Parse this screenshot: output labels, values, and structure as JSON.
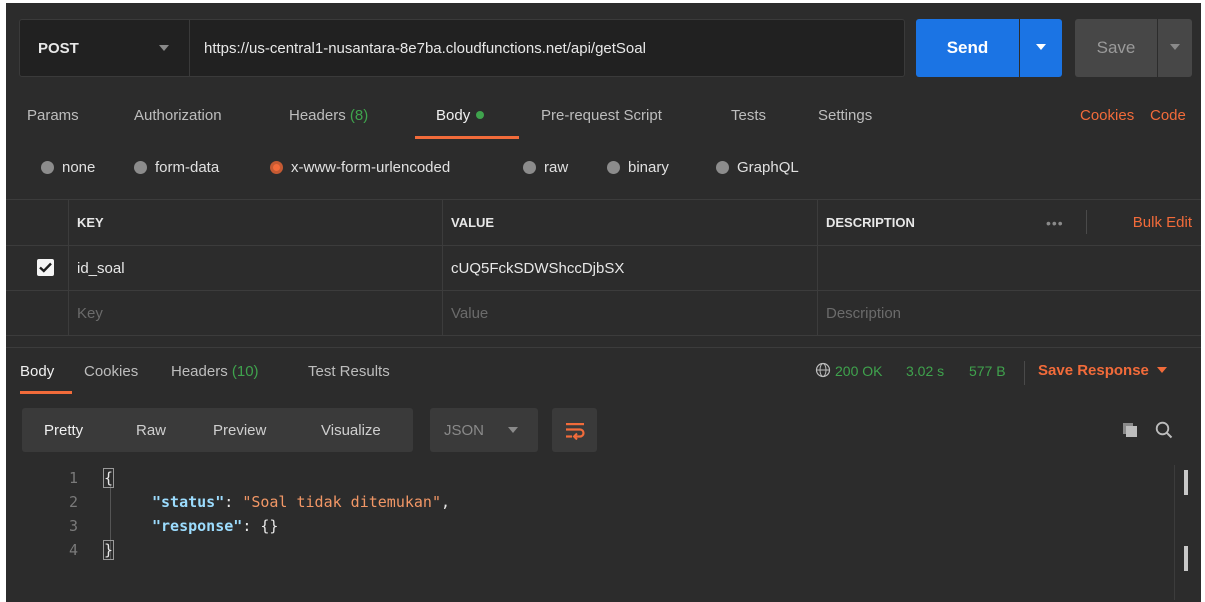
{
  "request": {
    "method": "POST",
    "url": "https://us-central1-nusantara-8e7ba.cloudfunctions.net/api/getSoal",
    "send_label": "Send",
    "save_label": "Save"
  },
  "request_tabs": {
    "params": "Params",
    "authorization": "Authorization",
    "headers": "Headers",
    "headers_count": "(8)",
    "body": "Body",
    "pre_request": "Pre-request Script",
    "tests": "Tests",
    "settings": "Settings",
    "cookies": "Cookies",
    "code": "Code"
  },
  "body_types": {
    "none": "none",
    "form_data": "form-data",
    "urlencoded": "x-www-form-urlencoded",
    "raw": "raw",
    "binary": "binary",
    "graphql": "GraphQL",
    "selected": "x-www-form-urlencoded"
  },
  "params_table": {
    "headers": {
      "key": "KEY",
      "value": "VALUE",
      "description": "DESCRIPTION"
    },
    "more": "•••",
    "bulk_edit": "Bulk Edit",
    "rows": [
      {
        "checked": true,
        "key": "id_soal",
        "value": "cUQ5FckSDWShccDjbSX",
        "description": ""
      }
    ],
    "placeholders": {
      "key": "Key",
      "value": "Value",
      "description": "Description"
    }
  },
  "response_tabs": {
    "body": "Body",
    "cookies": "Cookies",
    "headers": "Headers",
    "headers_count": "(10)",
    "test_results": "Test Results"
  },
  "response_meta": {
    "status": "200 OK",
    "time": "3.02 s",
    "size": "577 B",
    "save_response": "Save Response"
  },
  "view_modes": {
    "pretty": "Pretty",
    "raw": "Raw",
    "preview": "Preview",
    "visualize": "Visualize",
    "format": "JSON"
  },
  "code": {
    "line_numbers": [
      "1",
      "2",
      "3",
      "4"
    ],
    "open_brace": "{",
    "status_key": "\"status\"",
    "status_value": "\"Soal tidak ditemukan\"",
    "response_key": "\"response\"",
    "response_value": "{}",
    "close_brace": "}"
  },
  "colors": {
    "accent": "#f26b3a",
    "send": "#1b74e4",
    "success": "#3fa34d",
    "background": "#2c2c2c"
  }
}
